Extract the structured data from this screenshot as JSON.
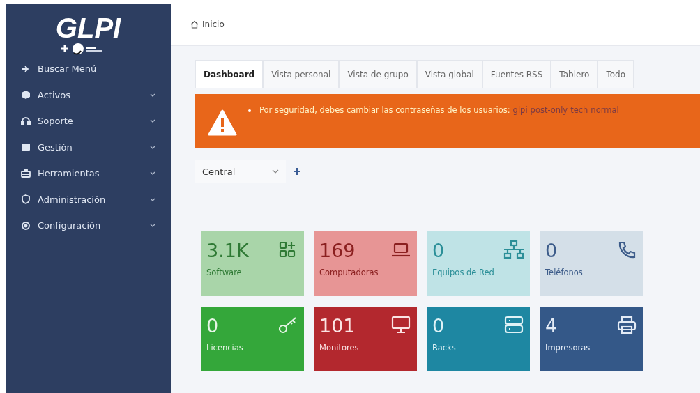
{
  "sidebar": {
    "logo": "GLPI",
    "items": [
      {
        "label": "Buscar Menú",
        "kind": "search",
        "has_submenu": false
      },
      {
        "label": "Activos",
        "kind": "assets",
        "has_submenu": true
      },
      {
        "label": "Soporte",
        "kind": "support",
        "has_submenu": true
      },
      {
        "label": "Gestión",
        "kind": "management",
        "has_submenu": true
      },
      {
        "label": "Herramientas",
        "kind": "tools",
        "has_submenu": true
      },
      {
        "label": "Administración",
        "kind": "admin",
        "has_submenu": true
      },
      {
        "label": "Configuración",
        "kind": "config",
        "has_submenu": true
      }
    ]
  },
  "breadcrumb": "Inicio",
  "tabs": [
    {
      "label": "Dashboard",
      "selected": true
    },
    {
      "label": "Vista personal",
      "selected": false
    },
    {
      "label": "Vista de grupo",
      "selected": false
    },
    {
      "label": "Vista global",
      "selected": false
    },
    {
      "label": "Fuentes RSS",
      "selected": false
    },
    {
      "label": "Tablero",
      "selected": false
    },
    {
      "label": "Todo",
      "selected": false
    }
  ],
  "alert": {
    "message": "Por seguridad, debes cambiar las contraseñas de los usuarios:",
    "links": [
      "glpi",
      "post-only",
      "tech",
      "normal"
    ]
  },
  "dashboard_select": {
    "value": "Central"
  },
  "cards": [
    {
      "value": "3.1K",
      "label": "Software",
      "kind": "software",
      "color": "#a9d5a9"
    },
    {
      "value": "169",
      "label": "Computadoras",
      "kind": "computer",
      "color": "#e79595"
    },
    {
      "value": "0",
      "label": "Equipos de Red",
      "kind": "network",
      "color": "#bfe3e6"
    },
    {
      "value": "0",
      "label": "Teléfonos",
      "kind": "phone",
      "color": "#d4dfe8"
    },
    {
      "value": "0",
      "label": "Licencias",
      "kind": "license",
      "color": "#34a73a"
    },
    {
      "value": "101",
      "label": "Monitores",
      "kind": "monitor",
      "color": "#b3282e"
    },
    {
      "value": "0",
      "label": "Racks",
      "kind": "rack",
      "color": "#1e87a2"
    },
    {
      "value": "4",
      "label": "Impresoras",
      "kind": "printer",
      "color": "#345888"
    }
  ]
}
